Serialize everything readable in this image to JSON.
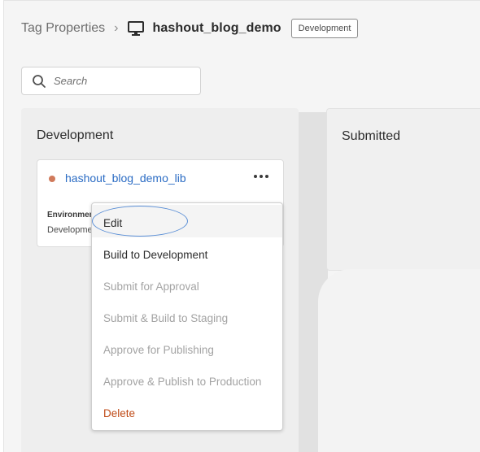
{
  "breadcrumb": {
    "parent_label": "Tag Properties",
    "separator": "›",
    "property_name": "hashout_blog_demo",
    "environment_badge": "Development"
  },
  "search": {
    "placeholder": "Search",
    "value": ""
  },
  "columns": [
    {
      "title": "Development"
    },
    {
      "title": "Submitted"
    }
  ],
  "library_card": {
    "status_color": "#d07a5b",
    "title": "hashout_blog_demo_lib",
    "environment_label": "Environment",
    "environment_value": "Development"
  },
  "context_menu": {
    "items": [
      {
        "label": "Edit",
        "state": "enabled"
      },
      {
        "label": "Build to Development",
        "state": "enabled"
      },
      {
        "label": "Submit for Approval",
        "state": "disabled"
      },
      {
        "label": "Submit & Build to Staging",
        "state": "disabled"
      },
      {
        "label": "Approve for Publishing",
        "state": "disabled"
      },
      {
        "label": "Approve & Publish to Production",
        "state": "disabled"
      },
      {
        "label": "Delete",
        "state": "danger"
      }
    ]
  },
  "colors": {
    "link": "#2b6cc4",
    "danger": "#bf4a16",
    "disabled_text": "#a3a3a3",
    "annotation": "#5b8fd6"
  },
  "icons": {
    "property": "monitor-icon",
    "search": "search-icon",
    "more": "more-horizontal-icon"
  }
}
